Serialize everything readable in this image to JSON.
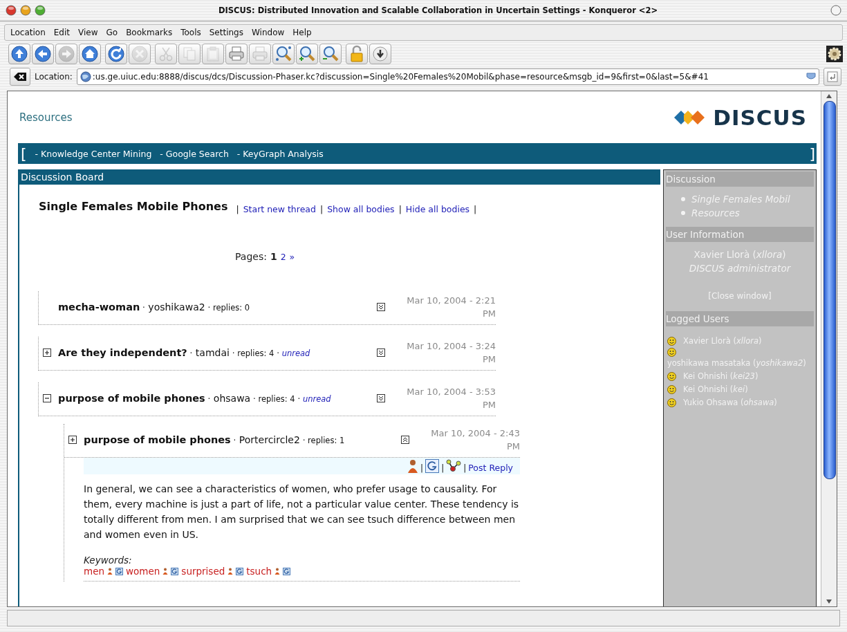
{
  "window": {
    "title": "DISCUS: Distributed Innovation and Scalable Collaboration in Uncertain Settings - Konqueror <2>"
  },
  "menu": [
    {
      "label": "Location"
    },
    {
      "label": "Edit"
    },
    {
      "label": "View"
    },
    {
      "label": "Go"
    },
    {
      "label": "Bookmarks"
    },
    {
      "label": "Tools"
    },
    {
      "label": "Settings"
    },
    {
      "label": "Window"
    },
    {
      "label": "Help"
    }
  ],
  "toolbar": [
    {
      "kind": "up",
      "disabled": false
    },
    {
      "kind": "back",
      "disabled": false
    },
    {
      "kind": "forward",
      "disabled": true
    },
    {
      "kind": "home",
      "disabled": false
    },
    {
      "kind": "reload",
      "disabled": false
    },
    {
      "kind": "stop",
      "disabled": true
    },
    {
      "kind": "cut",
      "disabled": true
    },
    {
      "kind": "copy",
      "disabled": true
    },
    {
      "kind": "paste",
      "disabled": true
    },
    {
      "kind": "print",
      "disabled": false
    },
    {
      "kind": "print",
      "disabled": true
    },
    {
      "kind": "find",
      "disabled": false
    },
    {
      "kind": "zoom-in",
      "disabled": false
    },
    {
      "kind": "zoom-out",
      "disabled": false
    },
    {
      "kind": "lock",
      "disabled": false
    },
    {
      "kind": "download",
      "disabled": false
    }
  ],
  "location_bar": {
    "label": "Location:",
    "url": ":us.ge.uiuc.edu:8888/discus/dcs/Discussion-Phaser.kc?discussion=Single%20Females%20Mobil&phase=resource&msgb_id=9&first=0&last=5&#41"
  },
  "page": {
    "header": "Resources",
    "logo": "DISCUS",
    "nav": {
      "open": "[",
      "links": [
        "- Knowledge Center Mining",
        "- Google Search",
        "- KeyGraph Analysis"
      ],
      "close": "]"
    },
    "board": {
      "title": "Discussion Board",
      "discussion_title": "Single Females Mobile Phones",
      "actions": [
        {
          "kind": "sep",
          "text": "|"
        },
        {
          "kind": "link",
          "text": "Start new thread"
        },
        {
          "kind": "sep",
          "text": "|"
        },
        {
          "kind": "link",
          "text": "Show all bodies"
        },
        {
          "kind": "sep",
          "text": "|"
        },
        {
          "kind": "link",
          "text": "Hide all bodies"
        },
        {
          "kind": "sep",
          "text": "|"
        }
      ],
      "pages": {
        "label": "Pages:",
        "items": [
          {
            "text": "1",
            "selected": true
          },
          {
            "text": "2",
            "selected": false
          },
          {
            "text": "»",
            "selected": false
          }
        ]
      },
      "threads": [
        {
          "title": "mecha-woman",
          "meta": [
            {
              "kind": "sep",
              "text": "·"
            },
            {
              "kind": "author",
              "text": "yoshikawa2"
            },
            {
              "kind": "sep",
              "text": "·"
            },
            {
              "kind": "replies",
              "text": "replies: 0"
            }
          ],
          "body_shown": false,
          "date": "Mar 10, 2004 - 2:21 PM"
        },
        {
          "title": "Are they independent?",
          "expanded": false,
          "meta": [
            {
              "kind": "sep",
              "text": "·"
            },
            {
              "kind": "author",
              "text": "tamdai"
            },
            {
              "kind": "sep",
              "text": "·"
            },
            {
              "kind": "replies",
              "text": "replies: 4"
            },
            {
              "kind": "sep",
              "text": "·"
            },
            {
              "kind": "unread",
              "text": "unread"
            }
          ],
          "body_shown": false,
          "date": "Mar 10, 2004 - 3:24 PM"
        },
        {
          "title": "purpose of mobile phones",
          "expanded": true,
          "meta": [
            {
              "kind": "sep",
              "text": "·"
            },
            {
              "kind": "author",
              "text": "ohsawa"
            },
            {
              "kind": "sep",
              "text": "·"
            },
            {
              "kind": "replies",
              "text": "replies: 4"
            },
            {
              "kind": "sep",
              "text": "·"
            },
            {
              "kind": "unread",
              "text": "unread"
            }
          ],
          "body_shown": false,
          "date": "Mar 10, 2004 - 3:53 PM",
          "children": [
            {
              "title": "purpose of mobile phones",
              "expanded": false,
              "meta": [
                {
                  "kind": "sep",
                  "text": "·"
                },
                {
                  "kind": "author",
                  "text": "Portercircle2"
                },
                {
                  "kind": "sep",
                  "text": "·"
                },
                {
                  "kind": "replies",
                  "text": "replies: 1"
                }
              ],
              "body_shown": true,
              "date": "Mar 10, 2004 - 2:43 PM",
              "body": {
                "tools": [
                  {
                    "kind": "person"
                  },
                  {
                    "kind": "sep",
                    "text": "|"
                  },
                  {
                    "kind": "g"
                  },
                  {
                    "kind": "sep",
                    "text": "|"
                  },
                  {
                    "kind": "graph"
                  },
                  {
                    "kind": "sep",
                    "text": "|"
                  },
                  {
                    "kind": "link",
                    "text": "Post Reply"
                  }
                ],
                "text": "In general, we can see a characteristics of women, who prefer usage to causality. For them, every machine is just a part of life, not a particular value center. These tendency is totally different from men. I am surprised that we can see tsuch difference between men and women even in US.",
                "keywords_label": "Keywords:",
                "keywords": [
                  "men",
                  "women",
                  "surprised",
                  "tsuch"
                ]
              }
            }
          ]
        }
      ]
    },
    "sidebar": {
      "sections": [
        {
          "kind": "links",
          "title": "Discussion",
          "items": [
            "Single Females Mobil",
            "Resources"
          ]
        },
        {
          "kind": "user",
          "title": "User Information",
          "name": "Xavier Llorà (*xllora*)",
          "role": "DISCUS administrator",
          "close": "[Close window]"
        },
        {
          "kind": "users",
          "title": "Logged Users",
          "items": [
            "Xavier Llorà (*xllora*)",
            "yoshikawa masataka (*yoshikawa2*)",
            "Kei Ohnishi (*kei23*)",
            "Kei Ohnishi (*kei*)",
            "Yukio Ohsawa (*ohsawa*)"
          ]
        }
      ]
    }
  }
}
